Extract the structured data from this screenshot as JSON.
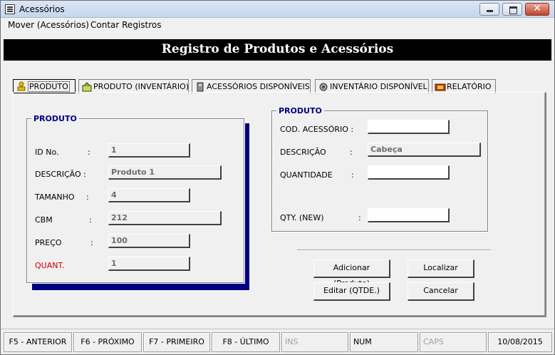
{
  "window": {
    "title": "Acessórios"
  },
  "menu": {
    "items": [
      "Mover (Acessórios)",
      "Contar Registros"
    ]
  },
  "header": {
    "title": "Registro de Produtos e Acessórios"
  },
  "tabs": [
    {
      "label": "PRODUTO",
      "icon": "product-icon"
    },
    {
      "label": "PRODUTO (INVENTÁRIO)",
      "icon": "inventory-icon"
    },
    {
      "label": "ACESSÓRIOS DISPONÍVEIS",
      "icon": "accessories-icon"
    },
    {
      "label": "INVENTÁRIO DISPONÍVEL",
      "icon": "network-icon"
    },
    {
      "label": "RELATÓRIO",
      "icon": "report-icon"
    }
  ],
  "produto_group": {
    "title": "PRODUTO",
    "fields": [
      {
        "label": "ID No.",
        "colon": ":",
        "value": "1"
      },
      {
        "label": "DESCRIÇÃO :",
        "colon": "",
        "value": "Produto 1"
      },
      {
        "label": "TAMANHO",
        "colon": ":",
        "value": "4"
      },
      {
        "label": "CBM",
        "colon": ":",
        "value": "212"
      },
      {
        "label": "PREÇO",
        "colon": ":",
        "value": "100"
      },
      {
        "label": "QUANT.",
        "colon": "",
        "value": "1",
        "label_color": "#d00000"
      }
    ]
  },
  "acessorio_group": {
    "title": "PRODUTO",
    "fields": [
      {
        "label": "COD. ACESSÓRIO :",
        "colon": "",
        "value": ""
      },
      {
        "label": "DESCRIÇÃO",
        "colon": ":",
        "value": "Cabeça"
      },
      {
        "label": "QUANTIDADE",
        "colon": ":",
        "value": ""
      },
      {
        "label": "QTY. (NEW)",
        "colon": ":",
        "value": ""
      }
    ]
  },
  "buttons": {
    "adicionar": "Adicionar (Produto)",
    "localizar": "Localizar",
    "editar": "Editar (QTDE.)",
    "cancelar": "Cancelar"
  },
  "status": {
    "f5": "F5 - ANTERIOR",
    "f6": "F6 - PRÓXIMO",
    "f7": "F7 - PRIMEIRO",
    "f8": "F8 - ÚLTIMO",
    "ins": "INS",
    "num": "NUM",
    "caps": "CAPS",
    "date": "10/08/2015"
  },
  "colors": {
    "accent": "#000080",
    "header_bg": "#000000",
    "warning_label": "#d00000"
  }
}
